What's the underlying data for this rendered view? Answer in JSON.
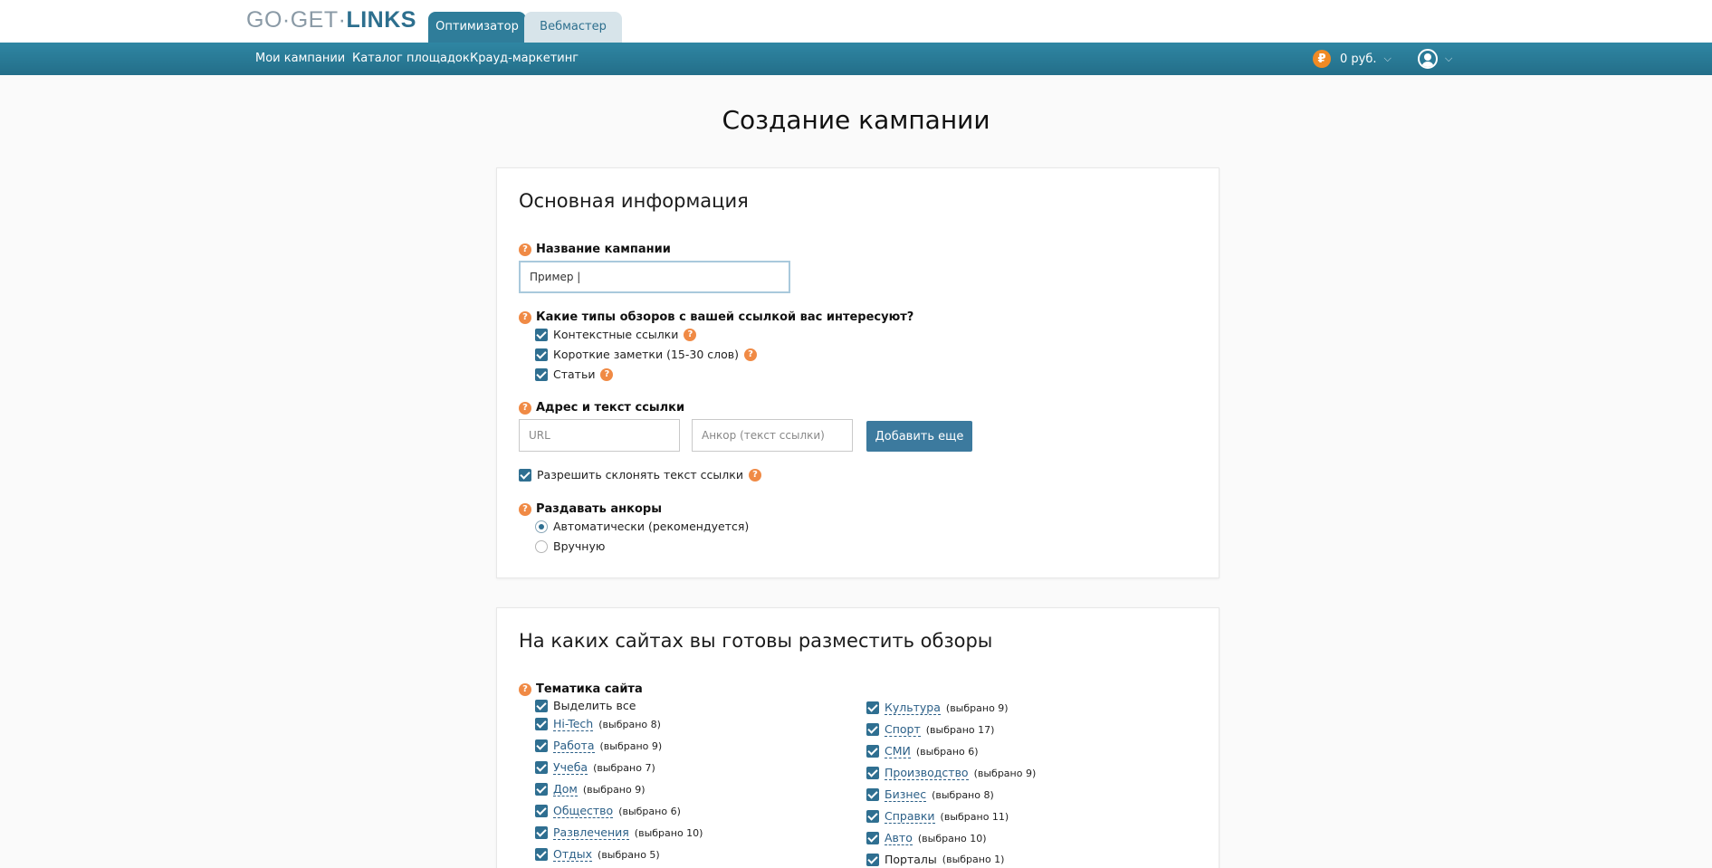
{
  "header": {
    "logo_part1": "GO·GET·",
    "logo_part2": "LINKS",
    "role_tabs": [
      {
        "label": "Оптимизатор",
        "active": true
      },
      {
        "label": "Вебмастер",
        "active": false
      }
    ],
    "nav": [
      "Мои кампании",
      "Каталог площадок",
      "Крауд-маркетинг"
    ],
    "balance": "0 руб.",
    "currency_icon": "₽",
    "accent_color": "#2f7d9a"
  },
  "page": {
    "title": "Создание кампании"
  },
  "basic_info": {
    "title": "Основная информация",
    "campaign_name_label": "Название кампании",
    "campaign_name_value": "Пример |",
    "review_types_label": "Какие типы обзоров с вашей ссылкой вас интересуют?",
    "review_types": [
      {
        "label": "Контекстные ссылки",
        "checked": true
      },
      {
        "label": "Короткие заметки (15-30 слов)",
        "checked": true
      },
      {
        "label": "Статьи",
        "checked": true
      }
    ],
    "link_label": "Адрес и текст ссылки",
    "url_placeholder": "URL",
    "anchor_placeholder": "Анкор (текст ссылки)",
    "add_more_button": "Добавить еще",
    "allow_decline_label": "Разрешить склонять текст ссылки",
    "distribute_label": "Раздавать анкоры",
    "distribute_options": [
      {
        "label": "Автоматически (рекомендуется)",
        "selected": true
      },
      {
        "label": "Вручную",
        "selected": false
      }
    ]
  },
  "sites": {
    "title": "На каких сайтах вы готовы разместить обзоры",
    "topic_label": "Тематика сайта",
    "select_all": "Выделить все",
    "left_topics": [
      {
        "name": "Hi-Tech",
        "count": "(выбрано 8)"
      },
      {
        "name": "Работа",
        "count": "(выбрано 9)"
      },
      {
        "name": "Учеба",
        "count": "(выбрано 7)"
      },
      {
        "name": "Дом",
        "count": "(выбрано 9)"
      },
      {
        "name": "Общество",
        "count": "(выбрано 6)"
      },
      {
        "name": "Развлечения",
        "count": "(выбрано 10)"
      },
      {
        "name": "Отдых",
        "count": "(выбрано 5)"
      }
    ],
    "right_topics": [
      {
        "name": "Культура",
        "count": "(выбрано 9)"
      },
      {
        "name": "Спорт",
        "count": "(выбрано 17)"
      },
      {
        "name": "СМИ",
        "count": "(выбрано 6)"
      },
      {
        "name": "Производство",
        "count": "(выбрано 9)"
      },
      {
        "name": "Бизнес",
        "count": "(выбрано 8)"
      },
      {
        "name": "Справки",
        "count": "(выбрано 11)"
      },
      {
        "name": "Авто",
        "count": "(выбрано 10)"
      },
      {
        "name": "Порталы",
        "count": "(выбрано 1)"
      }
    ]
  }
}
